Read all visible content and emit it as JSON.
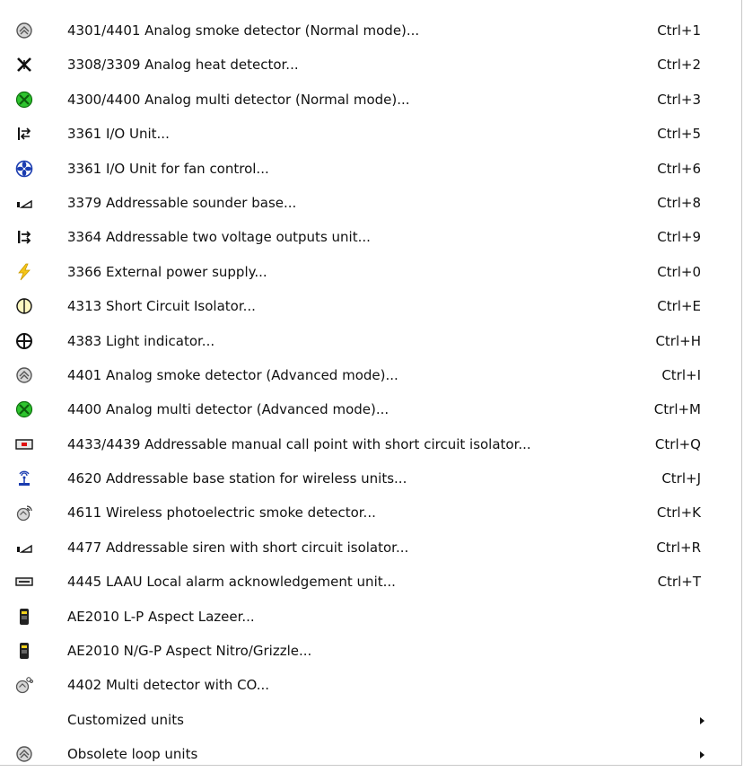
{
  "menu": {
    "items": [
      {
        "icon": "smoke-detector-icon",
        "label": "4301/4401 Analog smoke detector (Normal mode)...",
        "shortcut": "Ctrl+1"
      },
      {
        "icon": "heat-detector-icon",
        "label": "3308/3309 Analog heat detector...",
        "shortcut": "Ctrl+2"
      },
      {
        "icon": "multi-detector-icon",
        "label": "4300/4400 Analog multi detector (Normal mode)...",
        "shortcut": "Ctrl+3"
      },
      {
        "icon": "io-unit-icon",
        "label": "3361 I/O Unit...",
        "shortcut": "Ctrl+5"
      },
      {
        "icon": "fan-control-icon",
        "label": "3361 I/O Unit for fan control...",
        "shortcut": "Ctrl+6"
      },
      {
        "icon": "sounder-base-icon",
        "label": "3379 Addressable sounder base...",
        "shortcut": "Ctrl+8"
      },
      {
        "icon": "voltage-outputs-icon",
        "label": "3364 Addressable two voltage outputs unit...",
        "shortcut": "Ctrl+9"
      },
      {
        "icon": "power-supply-icon",
        "label": "3366 External power supply...",
        "shortcut": "Ctrl+0"
      },
      {
        "icon": "isolator-icon",
        "label": "4313 Short Circuit Isolator...",
        "shortcut": "Ctrl+E"
      },
      {
        "icon": "light-indicator-icon",
        "label": "4383 Light indicator...",
        "shortcut": "Ctrl+H"
      },
      {
        "icon": "smoke-detector-icon",
        "label": "4401 Analog smoke detector (Advanced mode)...",
        "shortcut": "Ctrl+I"
      },
      {
        "icon": "multi-detector-icon",
        "label": "4400 Analog multi detector (Advanced mode)...",
        "shortcut": "Ctrl+M"
      },
      {
        "icon": "call-point-icon",
        "label": "4433/4439 Addressable manual call point with short circuit isolator...",
        "shortcut": "Ctrl+Q"
      },
      {
        "icon": "base-station-icon",
        "label": "4620 Addressable base station for wireless units...",
        "shortcut": "Ctrl+J"
      },
      {
        "icon": "wireless-smoke-detector-icon",
        "label": "4611 Wireless photoelectric smoke detector...",
        "shortcut": "Ctrl+K"
      },
      {
        "icon": "siren-icon",
        "label": "4477 Addressable siren with short circuit isolator...",
        "shortcut": "Ctrl+R"
      },
      {
        "icon": "alarm-ack-unit-icon",
        "label": "4445 LAAU Local alarm acknowledgement unit...",
        "shortcut": "Ctrl+T"
      },
      {
        "icon": "aspect-detector-icon",
        "label": "AE2010 L-P Aspect Lazeer...",
        "shortcut": ""
      },
      {
        "icon": "aspect-detector-icon",
        "label": "AE2010 N/G-P Aspect Nitro/Grizzle...",
        "shortcut": ""
      },
      {
        "icon": "co-detector-icon",
        "label": "4402 Multi detector with CO...",
        "shortcut": ""
      },
      {
        "icon": "",
        "label": "Customized units",
        "shortcut": "",
        "submenu": true
      },
      {
        "icon": "smoke-detector-icon",
        "label": "Obsolete loop units",
        "shortcut": "",
        "submenu": true
      }
    ]
  }
}
